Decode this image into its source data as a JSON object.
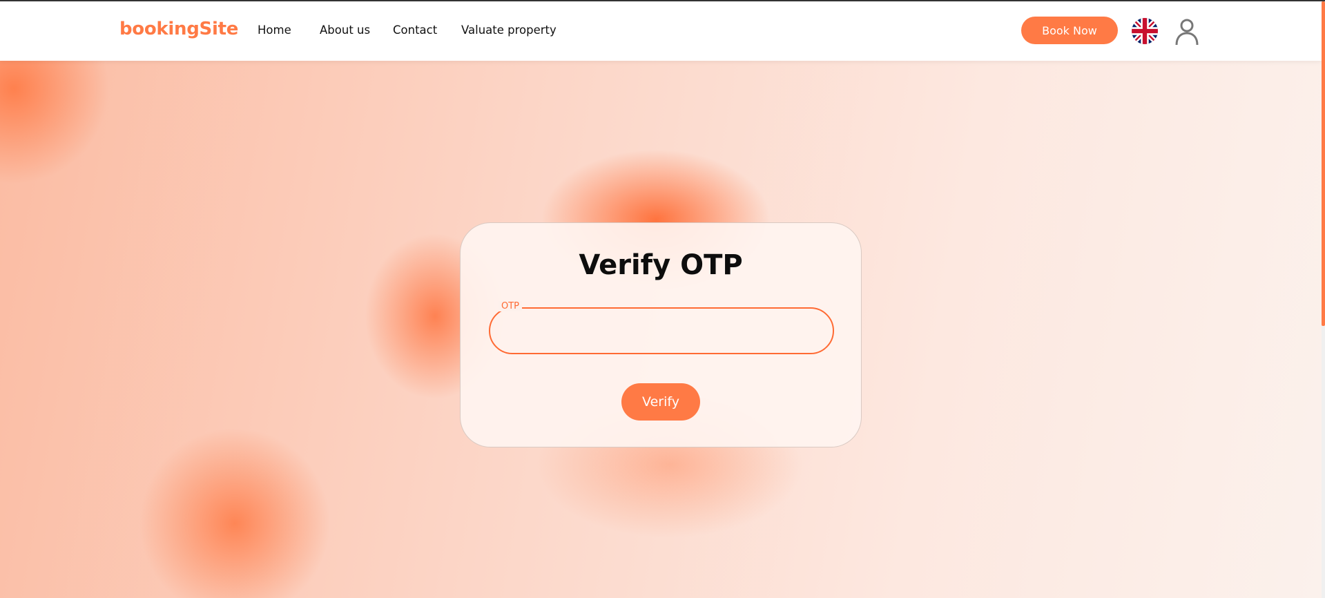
{
  "brand": {
    "name": "bookingSite",
    "color": "#ff7a45"
  },
  "nav": {
    "links": [
      {
        "label": "Home"
      },
      {
        "label": "About us"
      },
      {
        "label": "Contact"
      },
      {
        "label": "Valuate property"
      }
    ],
    "book_label": "Book Now",
    "language_icon": "uk-flag-icon",
    "account_icon": "user-icon"
  },
  "verify": {
    "title": "Verify OTP",
    "otp_label": "OTP",
    "otp_value": "",
    "button_label": "Verify"
  },
  "colors": {
    "accent": "#ff7a45",
    "field_border": "#ff6a33"
  }
}
